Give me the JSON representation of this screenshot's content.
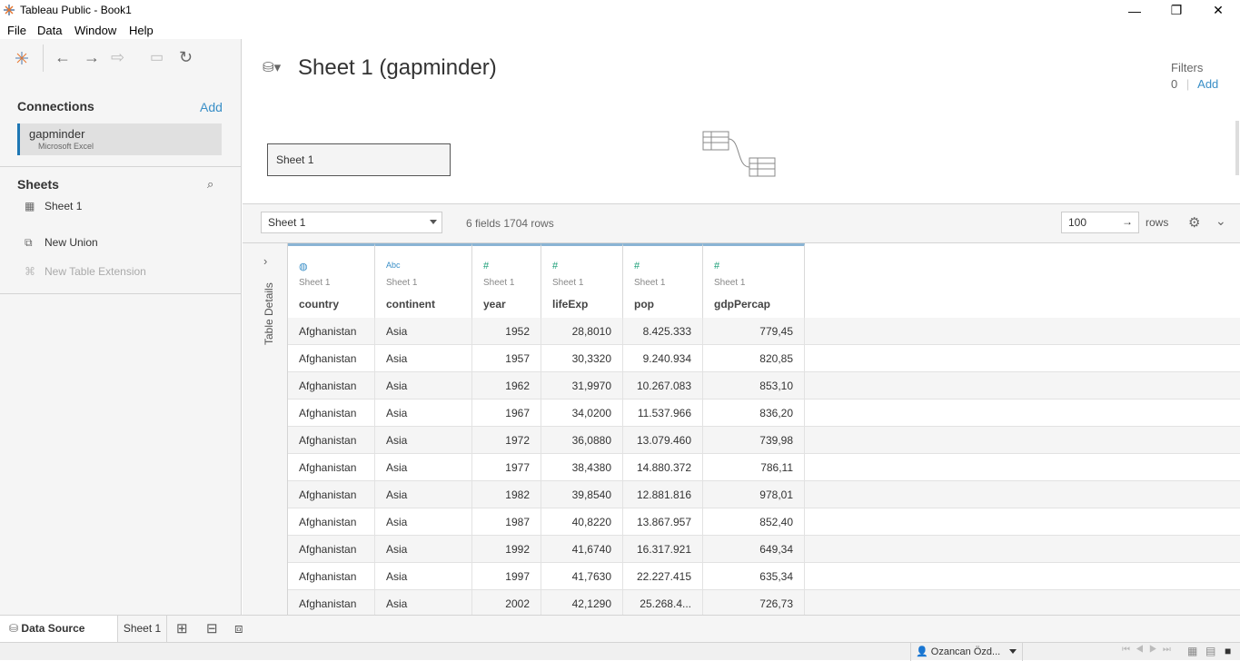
{
  "window": {
    "title": "Tableau Public - Book1",
    "minimize": "—",
    "maximize": "❐",
    "close": "✕"
  },
  "menu": [
    "File",
    "Data",
    "Window",
    "Help"
  ],
  "connections": {
    "heading": "Connections",
    "add": "Add",
    "name": "gapminder",
    "type": "Microsoft Excel"
  },
  "sheets": {
    "heading": "Sheets",
    "items": [
      "Sheet 1"
    ],
    "new_union": "New Union",
    "new_extension": "New Table Extension"
  },
  "canvas": {
    "title": "Sheet 1 (gapminder)",
    "filters_label": "Filters",
    "filters_count": "0",
    "filters_add": "Add",
    "table_box": "Sheet 1"
  },
  "grid": {
    "sheet_select": "Sheet 1",
    "info": "6 fields 1704 rows",
    "rows_value": "100",
    "rows_label": "rows",
    "side_label": "Table Details"
  },
  "columns": [
    {
      "icon": "globe-icon",
      "glyph": "◍",
      "source": "Sheet 1",
      "name": "country"
    },
    {
      "icon": "abc-icon",
      "glyph": "Abc",
      "source": "Sheet 1",
      "name": "continent"
    },
    {
      "icon": "number-icon",
      "glyph": "#",
      "source": "Sheet 1",
      "name": "year"
    },
    {
      "icon": "number-icon",
      "glyph": "#",
      "source": "Sheet 1",
      "name": "lifeExp"
    },
    {
      "icon": "number-icon",
      "glyph": "#",
      "source": "Sheet 1",
      "name": "pop"
    },
    {
      "icon": "number-icon",
      "glyph": "#",
      "source": "Sheet 1",
      "name": "gdpPercap"
    }
  ],
  "rows": [
    [
      "Afghanistan",
      "Asia",
      "1952",
      "28,8010",
      "8.425.333",
      "779,45"
    ],
    [
      "Afghanistan",
      "Asia",
      "1957",
      "30,3320",
      "9.240.934",
      "820,85"
    ],
    [
      "Afghanistan",
      "Asia",
      "1962",
      "31,9970",
      "10.267.083",
      "853,10"
    ],
    [
      "Afghanistan",
      "Asia",
      "1967",
      "34,0200",
      "11.537.966",
      "836,20"
    ],
    [
      "Afghanistan",
      "Asia",
      "1972",
      "36,0880",
      "13.079.460",
      "739,98"
    ],
    [
      "Afghanistan",
      "Asia",
      "1977",
      "38,4380",
      "14.880.372",
      "786,11"
    ],
    [
      "Afghanistan",
      "Asia",
      "1982",
      "39,8540",
      "12.881.816",
      "978,01"
    ],
    [
      "Afghanistan",
      "Asia",
      "1987",
      "40,8220",
      "13.867.957",
      "852,40"
    ],
    [
      "Afghanistan",
      "Asia",
      "1992",
      "41,6740",
      "16.317.921",
      "649,34"
    ],
    [
      "Afghanistan",
      "Asia",
      "1997",
      "41,7630",
      "22.227.415",
      "635,34"
    ],
    [
      "Afghanistan",
      "Asia",
      "2002",
      "42,1290",
      "25.268.4...",
      "726,73"
    ]
  ],
  "bottom_tabs": {
    "data_source": "Data Source",
    "sheet": "Sheet 1"
  },
  "status": {
    "user": "Ozancan Özd..."
  },
  "colors": {
    "accent": "#1f77b4",
    "link": "#3a8fc7",
    "number_icon": "#1a9e77",
    "text_icon": "#3a8fc7"
  }
}
